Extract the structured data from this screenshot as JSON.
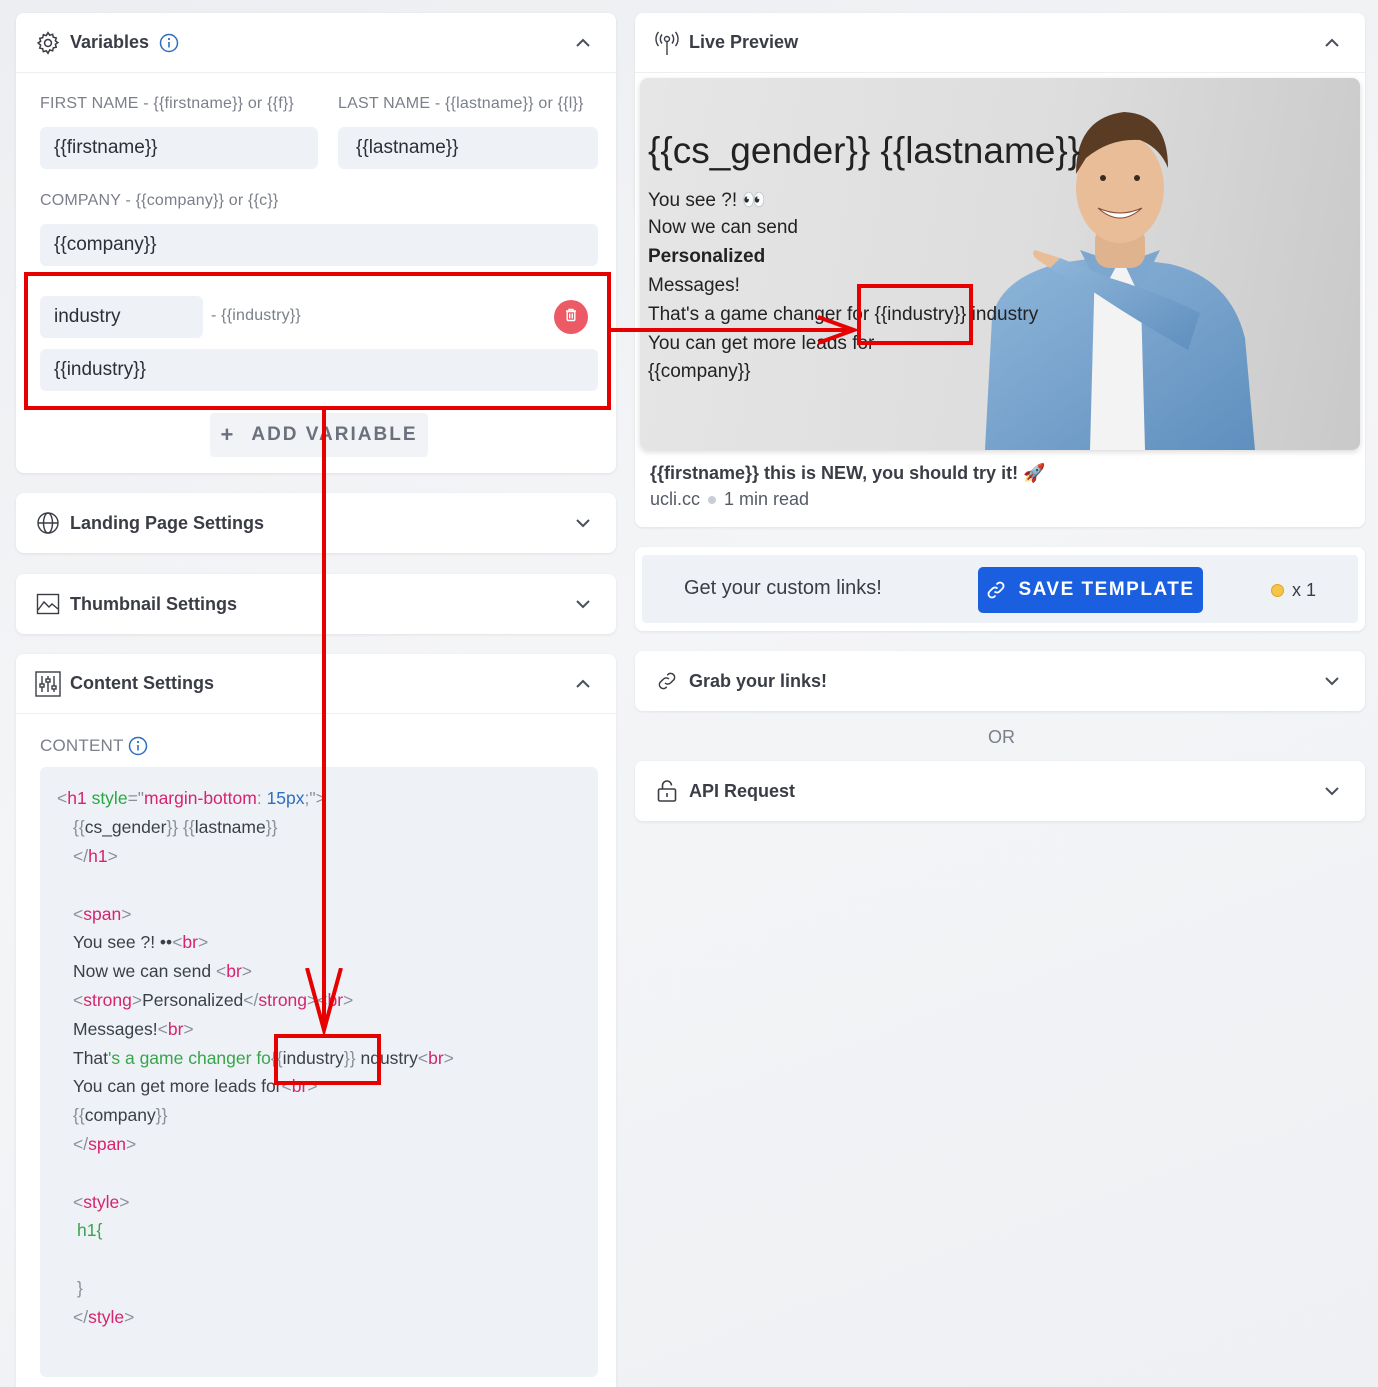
{
  "variables": {
    "title": "Variables",
    "first_name_label": "FIRST NAME - {{firstname}} or {{f}}",
    "first_name_value": "{{firstname}}",
    "last_name_label": "LAST NAME - {{lastname}} or {{l}}",
    "last_name_value": "{{lastname}}",
    "company_label": "COMPANY - {{company}} or {{c}}",
    "company_value": "{{company}}",
    "custom_name": "industry",
    "custom_tag": "- {{industry}}",
    "custom_value": "{{industry}}",
    "add_variable": "ADD VARIABLE",
    "add_plus": "+"
  },
  "landing_page": {
    "title": "Landing Page Settings"
  },
  "thumbnail": {
    "title": "Thumbnail Settings"
  },
  "content": {
    "title": "Content Settings",
    "label": "CONTENT",
    "code": {
      "l1_open": "<",
      "l1_tag": "h1",
      "l1_attr": " style",
      "l1_eq": "=\"",
      "l1_prop": "margin-bottom",
      "l1_colon": ": ",
      "l1_num": "15px",
      "l1_end": ";\">",
      "l2_a": "{{",
      "l2_b": "cs_gender",
      "l2_c": "}}",
      "l2_d": "{{",
      "l2_e": "lastname",
      "l2_f": "}}",
      "l3_a": "</",
      "l3_b": "h1",
      "l3_c": ">",
      "l5_a": "<",
      "l5_b": "span",
      "l5_c": ">",
      "l6_text": "You see ?! ••",
      "l7_text": "Now we can send ",
      "l8_text": "Personalized",
      "l8_tag1": "strong",
      "l8_tag2": "strong",
      "l9_text": "Messages!",
      "l10_a": "That",
      "l10_b": "'s a game changer fo",
      "l10_c": "{{",
      "l10_d": "industry",
      "l10_e": "}}",
      "l10_f": "ndustry",
      "l11_text": "You can get more leads for",
      "l12_a": "{{",
      "l12_b": "company",
      "l12_c": "}}",
      "l13_a": "</",
      "l13_b": "span",
      "l13_c": ">",
      "l15_a": "<",
      "l15_b": "style",
      "l15_c": ">",
      "l16_text": "h1{",
      "l18_text": "}",
      "l19_a": "</",
      "l19_b": "style",
      "l19_c": ">",
      "br": "br",
      "lt": "<",
      "gt": ">",
      "lts": "</"
    }
  },
  "live_preview": {
    "title": "Live Preview",
    "heading": "{{cs_gender}} {{lastname}}",
    "line1": "You see ?! 👀",
    "line2": "Now we can send",
    "line3": "Personalized",
    "line4": "Messages!",
    "line5_a": "That's a game changer for ",
    "line5_b": "{{industry}}",
    "line5_c": " industry",
    "line6": "You can get more leads for",
    "line7": "{{company}}",
    "caption_title": "{{firstname}} this is NEW, you should try it! 🚀",
    "site": "ucli.cc",
    "read_time": "1 min read"
  },
  "save_bar": {
    "text": "Get your custom links!",
    "button": "SAVE TEMPLATE",
    "credits": "x 1"
  },
  "grab_links": {
    "title": "Grab your links!"
  },
  "or_text": "OR",
  "api_request": {
    "title": "API Request"
  },
  "colors": {
    "accent": "#1a5fe0",
    "danger": "#ec5a66",
    "annotation": "#e60000"
  }
}
